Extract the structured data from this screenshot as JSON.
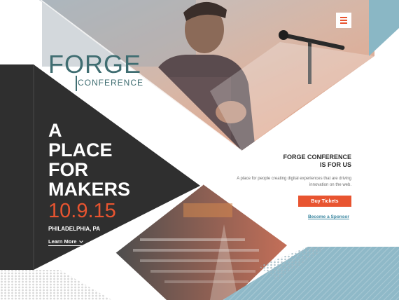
{
  "brand": {
    "logo_word": "FORGE",
    "logo_sub": "CONFERENCE"
  },
  "menu": {
    "icon": "hamburger-icon"
  },
  "hero": {
    "title_lines": [
      "A",
      "PLACE",
      "FOR",
      "MAKERS"
    ],
    "date": "10.9.15",
    "location": "PHILADELPHIA, PA",
    "learn_more": "Learn More"
  },
  "about": {
    "title_lines": [
      "FORGE CONFERENCE",
      "IS FOR US"
    ],
    "description": "A place for people creating digital experiences that are driving innovation on the web.",
    "tickets_label": "Buy Tickets",
    "sponsor_label": "Become a Sponsor"
  },
  "colors": {
    "dark": "#2f2f2f",
    "accent": "#e85430",
    "teal": "#3f6d71",
    "blue": "#8ab7c5",
    "link": "#3a86a0"
  },
  "images": {
    "speaker": "speaker-photo",
    "audience": "audience-photo"
  }
}
